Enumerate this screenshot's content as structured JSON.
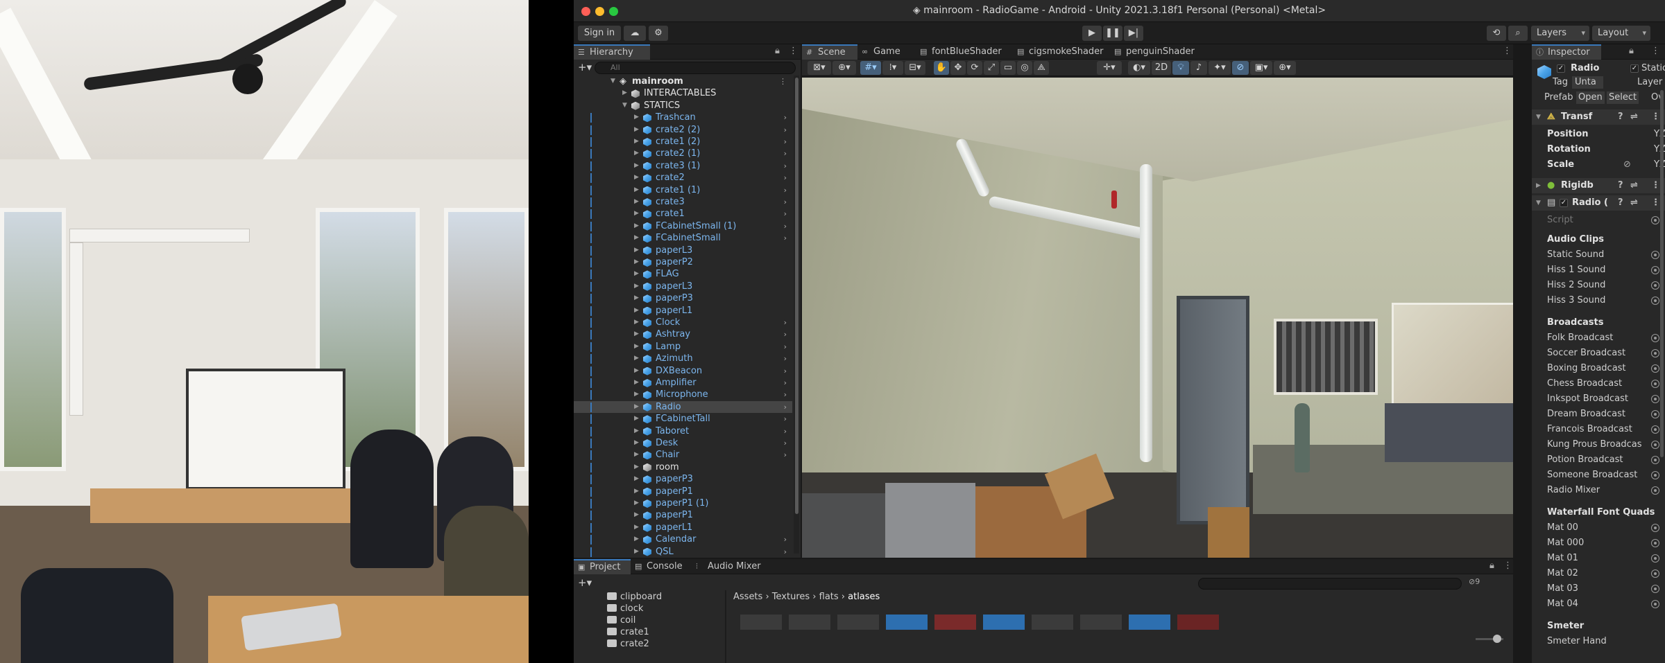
{
  "window": {
    "title": "mainroom - RadioGame - Android - Unity 2021.3.18f1 Personal (Personal) <Metal>"
  },
  "toolbar": {
    "sign_in": "Sign in",
    "layers": "Layers",
    "layout": "Layout"
  },
  "hierarchy": {
    "tab": "Hierarchy",
    "search_placeholder": "All",
    "items": [
      {
        "label": "mainroom",
        "depth": 0,
        "kind": "scene",
        "expanded": true
      },
      {
        "label": "INTERACTABLES",
        "depth": 1,
        "kind": "grey",
        "expanded": false
      },
      {
        "label": "STATICS",
        "depth": 1,
        "kind": "grey",
        "expanded": true
      },
      {
        "label": "Trashcan",
        "depth": 2,
        "kind": "blue",
        "chev": true
      },
      {
        "label": "crate2 (2)",
        "depth": 2,
        "kind": "blue",
        "chev": true
      },
      {
        "label": "crate1 (2)",
        "depth": 2,
        "kind": "blue",
        "chev": true
      },
      {
        "label": "crate2 (1)",
        "depth": 2,
        "kind": "blue",
        "chev": true
      },
      {
        "label": "crate3 (1)",
        "depth": 2,
        "kind": "blue",
        "chev": true
      },
      {
        "label": "crate2",
        "depth": 2,
        "kind": "blue",
        "chev": true
      },
      {
        "label": "crate1 (1)",
        "depth": 2,
        "kind": "blue",
        "chev": true
      },
      {
        "label": "crate3",
        "depth": 2,
        "kind": "blue",
        "chev": true
      },
      {
        "label": "crate1",
        "depth": 2,
        "kind": "blue",
        "chev": true
      },
      {
        "label": "FCabinetSmall (1)",
        "depth": 2,
        "kind": "blue",
        "chev": true
      },
      {
        "label": "FCabinetSmall",
        "depth": 2,
        "kind": "blue",
        "chev": true
      },
      {
        "label": "paperL3",
        "depth": 2,
        "kind": "blue",
        "chev": false
      },
      {
        "label": "paperP2",
        "depth": 2,
        "kind": "blue",
        "chev": false
      },
      {
        "label": "FLAG",
        "depth": 2,
        "kind": "blue",
        "chev": false
      },
      {
        "label": "paperL3",
        "depth": 2,
        "kind": "blue",
        "chev": false
      },
      {
        "label": "paperP3",
        "depth": 2,
        "kind": "blue",
        "chev": false
      },
      {
        "label": "paperL1",
        "depth": 2,
        "kind": "blue",
        "chev": false
      },
      {
        "label": "Clock",
        "depth": 2,
        "kind": "blue",
        "chev": true
      },
      {
        "label": "Ashtray",
        "depth": 2,
        "kind": "blue",
        "chev": true
      },
      {
        "label": "Lamp",
        "depth": 2,
        "kind": "blue",
        "chev": true
      },
      {
        "label": "Azimuth",
        "depth": 2,
        "kind": "blue",
        "chev": true
      },
      {
        "label": "DXBeacon",
        "depth": 2,
        "kind": "blue",
        "chev": true
      },
      {
        "label": "Amplifier",
        "depth": 2,
        "kind": "blue",
        "chev": true
      },
      {
        "label": "Microphone",
        "depth": 2,
        "kind": "blue",
        "chev": true
      },
      {
        "label": "Radio",
        "depth": 2,
        "kind": "blue",
        "chev": true,
        "selected": true
      },
      {
        "label": "FCabinetTall",
        "depth": 2,
        "kind": "blue",
        "chev": true
      },
      {
        "label": "Taboret",
        "depth": 2,
        "kind": "blue",
        "chev": true
      },
      {
        "label": "Desk",
        "depth": 2,
        "kind": "blue",
        "chev": true
      },
      {
        "label": "Chair",
        "depth": 2,
        "kind": "blue",
        "chev": true
      },
      {
        "label": "room",
        "depth": 2,
        "kind": "grey",
        "chev": false
      },
      {
        "label": "paperP3",
        "depth": 2,
        "kind": "blue",
        "chev": false
      },
      {
        "label": "paperP1",
        "depth": 2,
        "kind": "blue",
        "chev": false
      },
      {
        "label": "paperP1 (1)",
        "depth": 2,
        "kind": "blue",
        "chev": false
      },
      {
        "label": "paperP1",
        "depth": 2,
        "kind": "blue",
        "chev": false
      },
      {
        "label": "paperL1",
        "depth": 2,
        "kind": "blue",
        "chev": false
      },
      {
        "label": "Calendar",
        "depth": 2,
        "kind": "blue",
        "chev": true
      },
      {
        "label": "QSL",
        "depth": 2,
        "kind": "blue",
        "chev": true
      }
    ]
  },
  "scene_tabs": [
    {
      "label": "Scene",
      "icon": "#",
      "active": true
    },
    {
      "label": "Game",
      "icon": "∞",
      "active": false
    },
    {
      "label": "fontBlueShader",
      "icon": "▤",
      "active": false
    },
    {
      "label": "cigsmokeShader",
      "icon": "▤",
      "active": false
    },
    {
      "label": "penguinShader",
      "icon": "▤",
      "active": false
    }
  ],
  "scene_toolbar": {
    "mode_2d": "2D"
  },
  "inspector": {
    "tab": "Inspector",
    "object_name": "Radio",
    "static_label": "Static",
    "tag_label": "Tag",
    "tag_value": "Unta",
    "layer_label": "Layer",
    "prefab_label": "Prefab",
    "prefab_open": "Open",
    "prefab_select": "Select",
    "prefab_ov": "Ov",
    "transform": "Transf",
    "position": "Position",
    "rotation": "Rotation",
    "scale": "Scale",
    "xyz": "YZ",
    "rigidbody": "Rigidb",
    "radio_comp": "Radio (",
    "script_label": "Script",
    "audio_clips_header": "Audio Clips",
    "audio_clips": [
      "Static Sound",
      "Hiss 1 Sound",
      "Hiss 2 Sound",
      "Hiss 3 Sound"
    ],
    "broadcasts_header": "Broadcasts",
    "broadcasts": [
      "Folk Broadcast",
      "Soccer Broadcast",
      "Boxing Broadcast",
      "Chess Broadcast",
      "Inkspot Broadcast",
      "Dream Broadcast",
      "Francois Broadcast",
      "Kung Prous Broadcas",
      "Potion Broadcast",
      "Someone Broadcast",
      "Radio Mixer"
    ],
    "quads_header": "Waterfall Font Quads",
    "quads": [
      "Mat 00",
      "Mat 000",
      "Mat 01",
      "Mat 02",
      "Mat 03",
      "Mat 04"
    ],
    "smeter_header": "Smeter",
    "smeter_item": "Smeter Hand"
  },
  "project": {
    "tabs": [
      {
        "label": "Project",
        "icon": "▣",
        "active": true
      },
      {
        "label": "Console",
        "icon": "▤",
        "active": false
      },
      {
        "label": "Audio Mixer",
        "icon": "⫶",
        "active": false
      }
    ],
    "folders": [
      "clipboard",
      "clock",
      "coil",
      "crate1",
      "crate2"
    ],
    "breadcrumb": [
      "Assets",
      "Textures",
      "flats",
      "atlases"
    ],
    "hidden_count": "9"
  },
  "colors": {
    "accent": "#3a79bb",
    "prefab_text": "#7cb6ee",
    "panel_bg": "#282828"
  }
}
